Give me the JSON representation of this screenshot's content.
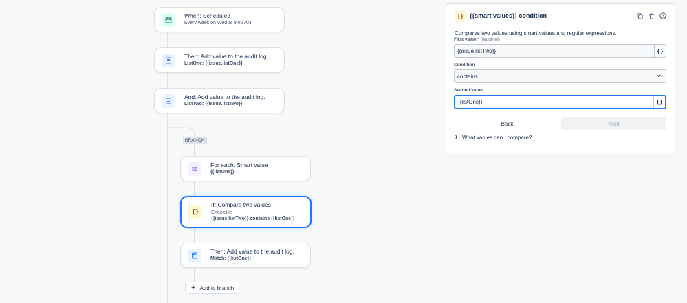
{
  "flow": {
    "trigger": {
      "title": "When: Scheduled",
      "subtitle": "Every week on Wed at 9:00 AM",
      "icon": "calendar-icon"
    },
    "action1": {
      "title": "Then: Add value to the audit log.",
      "subtitle": "ListOne: {{issue.listOne}}",
      "icon": "audit-log-icon"
    },
    "action2": {
      "title": "And: Add value to the audit log.",
      "subtitle": "ListTwo: {{issue.listTwo}}",
      "icon": "audit-log-icon"
    },
    "branch_label": "BRANCH",
    "foreach": {
      "title": "For each: Smart value",
      "subtitle": "{{listOne}}",
      "icon": "list-icon"
    },
    "condition": {
      "title": "If: Compare two values",
      "subtitle1": "Checks if:",
      "subtitle2": "{{issue.listTwo}} contains {{listOne}}",
      "icon": "braces-icon"
    },
    "action3": {
      "title": "Then: Add value to the audit log.",
      "subtitle": "Match: {{listOne}}",
      "icon": "audit-log-icon"
    },
    "add_branch": "Add to branch"
  },
  "panel": {
    "title": "{{smart values}} condition",
    "description": "Compares two values using smart values and regular expressions.",
    "first_value_label": "First value",
    "required_star": "*",
    "required_text": "(required)",
    "first_value": "{{issue.listTwo}}",
    "condition_label": "Condition",
    "condition_value": "contains",
    "second_value_label": "Second value",
    "second_value": "{{listOne}}",
    "brace_button": "{}",
    "back_label": "Back",
    "next_label": "Next",
    "expander_label": "What values can I compare?"
  },
  "colors": {
    "selected_border": "#1d7afc",
    "trigger_icon_bg": "#dcfff1",
    "action_icon_bg": "#e9f2ff",
    "condition_icon_bg": "#fff7d6",
    "foreach_icon_bg": "#f3f0ff"
  }
}
